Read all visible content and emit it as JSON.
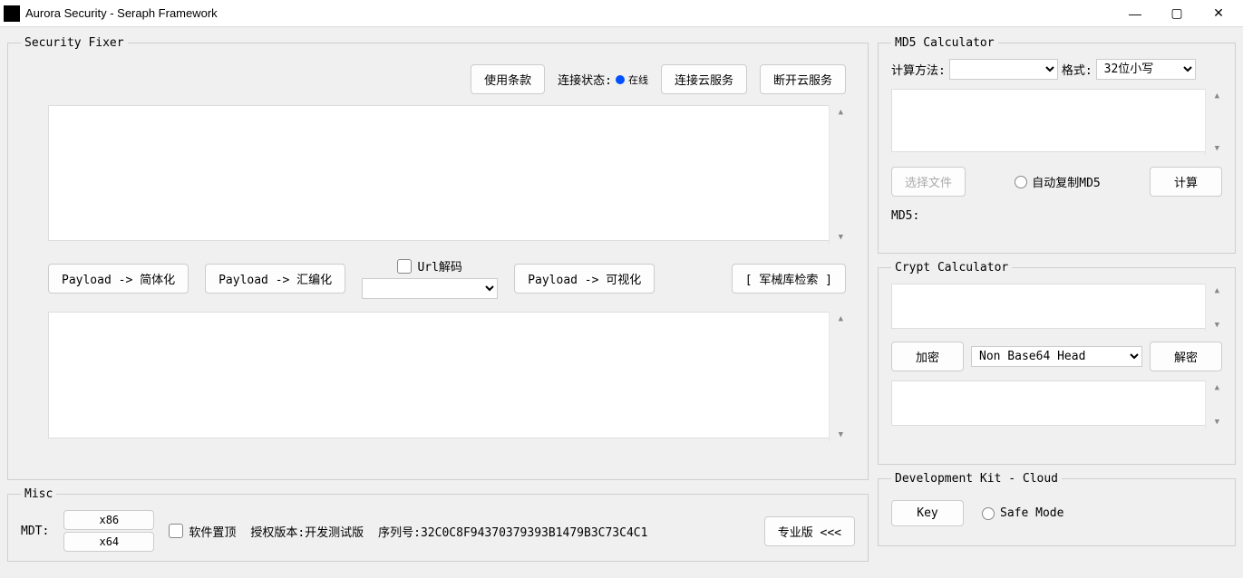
{
  "window": {
    "title": "Aurora Security - Seraph Framework"
  },
  "security_fixer": {
    "legend": "Security Fixer",
    "usage_terms_btn": "使用条款",
    "conn_status_label": "连接状态:",
    "conn_status_value": "在线",
    "connect_cloud_btn": "连接云服务",
    "disconnect_cloud_btn": "断开云服务",
    "payload_simplify_btn": "Payload -> 简体化",
    "payload_assembly_btn": "Payload -> 汇编化",
    "url_decode_label": "Url解码",
    "payload_visual_btn": "Payload -> 可视化",
    "armory_search_btn": "[ 军械库检索 ]"
  },
  "misc": {
    "legend": "Misc",
    "mdt_label": "MDT:",
    "x86_btn": "x86",
    "x64_btn": "x64",
    "pin_top_label": "软件置顶",
    "license_label": "授权版本:开发测试版",
    "serial_label": "序列号:32C0C8F94370379393B1479B3C73C4C1",
    "pro_btn": "专业版 <<<"
  },
  "md5_calc": {
    "legend": "MD5 Calculator",
    "method_label": "计算方法:",
    "format_label": "格式:",
    "format_value": "32位小写",
    "choose_file_btn": "选择文件",
    "auto_copy_label": "自动复制MD5",
    "compute_btn": "计算",
    "result_label": "MD5:"
  },
  "crypt_calc": {
    "legend": "Crypt Calculator",
    "encrypt_btn": "加密",
    "mode_value": "Non Base64 Head",
    "decrypt_btn": "解密"
  },
  "dev_kit": {
    "legend": "Development Kit - Cloud",
    "key_btn": "Key",
    "safe_mode_label": "Safe Mode"
  }
}
